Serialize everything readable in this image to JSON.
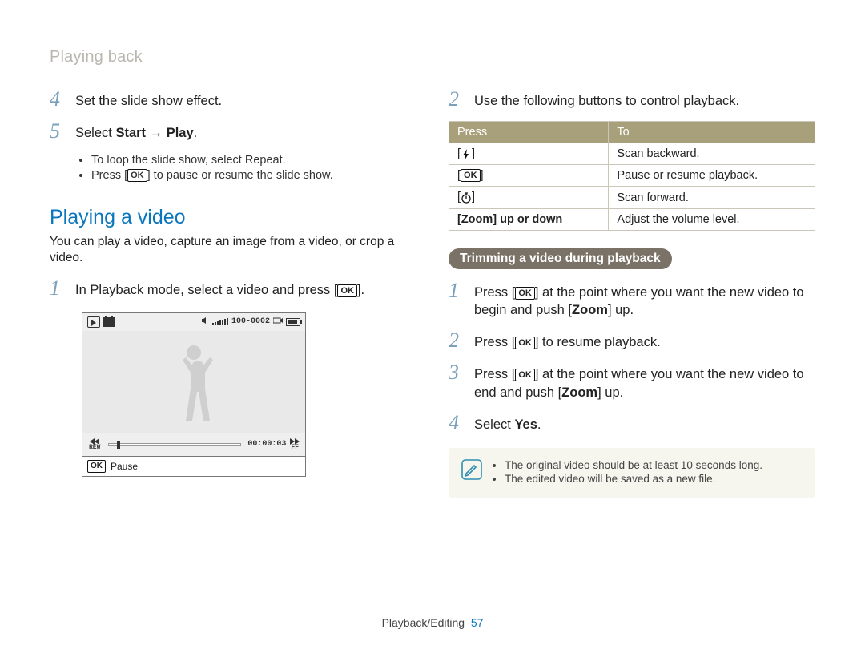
{
  "running_head": "Playing back",
  "left": {
    "step4": {
      "num": "4",
      "text": "Set the slide show effect."
    },
    "step5": {
      "num": "5",
      "prefix": "Select ",
      "bold1": "Start",
      "arrow": " → ",
      "bold2": "Play",
      "suffix": ".",
      "sub": [
        {
          "pre": "To loop the slide show, select ",
          "bold": "Repeat",
          "post": "."
        },
        {
          "pre": "Press [",
          "ok": "OK",
          "post": "] to pause or resume the slide show."
        }
      ]
    },
    "section_title": "Playing a video",
    "section_intro": "You can play a video, capture an image from a video, or crop a video.",
    "step1": {
      "num": "1",
      "pre": "In Playback mode, select a video and press [",
      "ok": "OK",
      "post": "]."
    },
    "camera": {
      "file_counter": "100-0002",
      "timestamp": "00:00:03",
      "rew": "REW",
      "ff": "FF",
      "ok": "OK",
      "caption": "Pause"
    }
  },
  "right": {
    "step2": {
      "num": "2",
      "text": "Use the following buttons to control playback."
    },
    "table": {
      "head": {
        "c1": "Press",
        "c2": "To"
      },
      "rows": [
        {
          "iconName": "flash-icon",
          "keytext": "",
          "to": "Scan backward."
        },
        {
          "iconName": "ok-icon",
          "keytext": "OK",
          "to": "Pause or resume playback."
        },
        {
          "iconName": "timer-icon",
          "keytext": "",
          "to": "Scan forward."
        },
        {
          "iconName": "",
          "keytext": "[Zoom] up or down",
          "to": "Adjust the volume level."
        }
      ]
    },
    "pill": "Trimming a video during playback",
    "trim": {
      "s1": {
        "num": "1",
        "pre": "Press [",
        "ok": "OK",
        "mid": "] at the point where you want the new video to begin and push [",
        "bold": "Zoom",
        "post": "] up."
      },
      "s2": {
        "num": "2",
        "pre": "Press [",
        "ok": "OK",
        "post": "] to resume playback."
      },
      "s3": {
        "num": "3",
        "pre": "Press [",
        "ok": "OK",
        "mid": "] at the point where you want the new video to end and push [",
        "bold": "Zoom",
        "post": "] up."
      },
      "s4": {
        "num": "4",
        "pre": "Select ",
        "bold": "Yes",
        "post": "."
      }
    },
    "note": {
      "items": [
        "The original video should be at least 10 seconds long.",
        "The edited video will be saved as a new file."
      ]
    }
  },
  "footer": {
    "section": "Playback/Editing",
    "page": "57"
  }
}
